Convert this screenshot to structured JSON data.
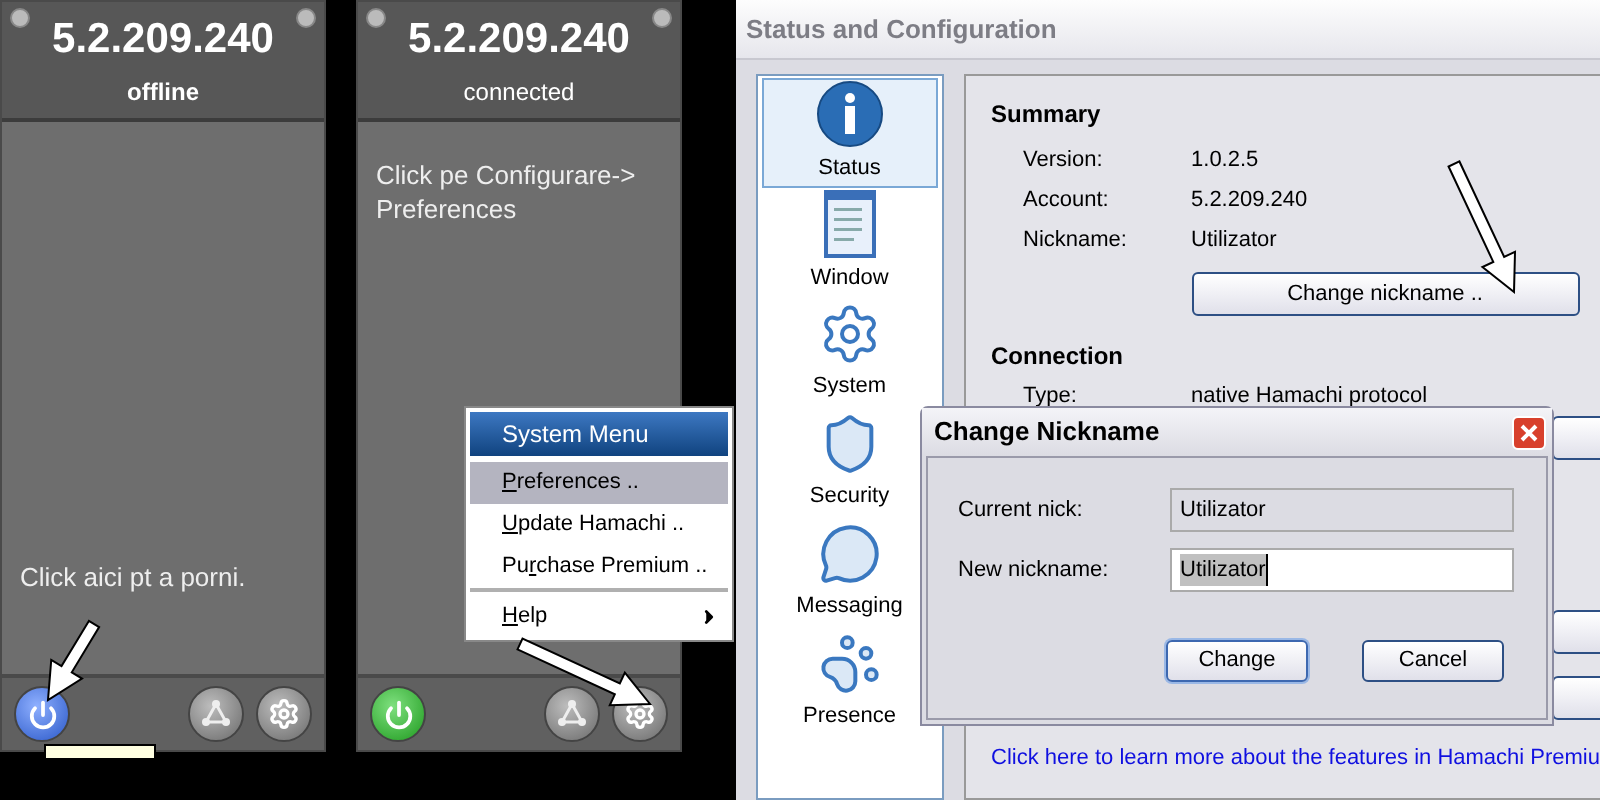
{
  "panels": [
    {
      "ip": "5.2.209.240",
      "status": "offline",
      "message": "Click aici pt a porni.",
      "kind": "bottom",
      "power_on": false,
      "tooltip_shown": true
    },
    {
      "ip": "5.2.209.240",
      "status": "connected",
      "message": "Click pe Configurare-> Preferences",
      "kind": "top",
      "power_on": true,
      "tooltip_shown": false
    }
  ],
  "system_menu": {
    "title": "System Menu",
    "items": [
      {
        "accel": "P",
        "after": "references ..",
        "selected": true,
        "submenu": false,
        "divider_before": false
      },
      {
        "accel": "U",
        "after": "pdate Hamachi ..",
        "selected": false,
        "submenu": false,
        "divider_before": false
      },
      {
        "before": "Pu",
        "accel": "r",
        "after": "chase Premium ..",
        "selected": false,
        "submenu": false,
        "divider_before": false
      },
      {
        "accel": "H",
        "after": "elp",
        "selected": false,
        "submenu": true,
        "divider_before": true
      }
    ]
  },
  "config": {
    "title": "Status and Configuration",
    "sidebar": [
      {
        "kind": "info",
        "label": "Status",
        "selected": true
      },
      {
        "kind": "window",
        "label": "Window",
        "selected": false
      },
      {
        "kind": "gear",
        "label": "System",
        "selected": false
      },
      {
        "kind": "shield",
        "label": "Security",
        "selected": false
      },
      {
        "kind": "bubble",
        "label": "Messaging",
        "selected": false
      },
      {
        "kind": "paw",
        "label": "Presence",
        "selected": false
      }
    ],
    "summary": {
      "heading": "Summary",
      "rows": [
        {
          "label": "Version:",
          "value": "1.0.2.5"
        },
        {
          "label": "Account:",
          "value": "5.2.209.240"
        },
        {
          "label": "Nickname:",
          "value": "Utilizator"
        }
      ],
      "button": "Change nickname .."
    },
    "connection": {
      "heading": "Connection",
      "rows": [
        {
          "label": "Type:",
          "value": "native Hamachi protocol"
        }
      ]
    },
    "link": "Click here to learn more about the features in Hamachi Premiu"
  },
  "dialog": {
    "title": "Change Nickname",
    "current_label": "Current nick:",
    "current_value": "Utilizator",
    "new_label": "New nickname:",
    "new_value": "Utilizator",
    "buttons": [
      "Change",
      "Cancel"
    ]
  }
}
